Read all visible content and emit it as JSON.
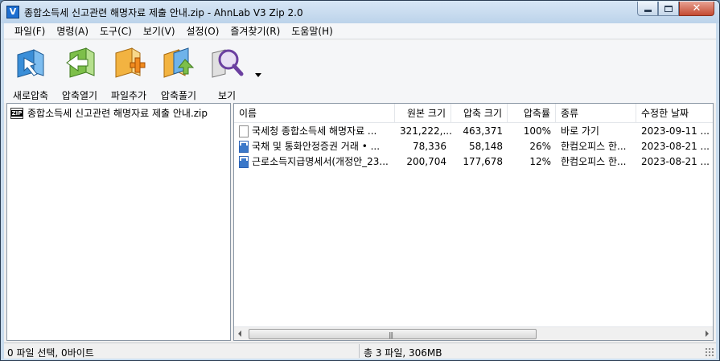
{
  "window": {
    "title": "종합소득세 신고관련 해명자료 제출 안내.zip - AhnLab V3 Zip 2.0",
    "app_icon": "V"
  },
  "menu": [
    "파일(F)",
    "명령(A)",
    "도구(C)",
    "보기(V)",
    "설정(O)",
    "즐겨찾기(R)",
    "도움말(H)"
  ],
  "toolbar": {
    "new_archive": "새로압축",
    "open_archive": "압축열기",
    "add_files": "파일추가",
    "extract": "압축풀기",
    "view": "보기"
  },
  "tree": {
    "root_label": "종합소득세 신고관련 해명자료 제출 안내.zip"
  },
  "list": {
    "columns": {
      "name": "이름",
      "original_size": "원본 크기",
      "compressed_size": "압축 크기",
      "ratio": "압축률",
      "type": "종류",
      "modified": "수정한 날짜"
    },
    "rows": [
      {
        "name": "국세청 종합소득세 해명자료 ...",
        "original_size": "321,222,...",
        "compressed_size": "463,371",
        "ratio": "100%",
        "type": "바로 가기",
        "modified": "2023-09-11 ...",
        "icon": "shortcut-file-icon"
      },
      {
        "name": "국채 및 통화안정증권 거래 • ...",
        "original_size": "78,336",
        "compressed_size": "58,148",
        "ratio": "26%",
        "type": "한컴오피스 한...",
        "modified": "2023-08-21 ...",
        "icon": "hwp-document-icon"
      },
      {
        "name": "근로소득지급명세서(개정안_23...",
        "original_size": "200,704",
        "compressed_size": "177,678",
        "ratio": "12%",
        "type": "한컴오피스 한...",
        "modified": "2023-08-21 ...",
        "icon": "hwp-document-icon"
      }
    ]
  },
  "scrollbar": {
    "grip": "|||"
  },
  "status": {
    "selection": "0 파일 선택, 0바이트",
    "total": "총 3 파일, 306MB"
  },
  "colors": {
    "titlebar": "#c9dcee",
    "close_button": "#c44a31",
    "app_icon": "#1d6fd1"
  }
}
